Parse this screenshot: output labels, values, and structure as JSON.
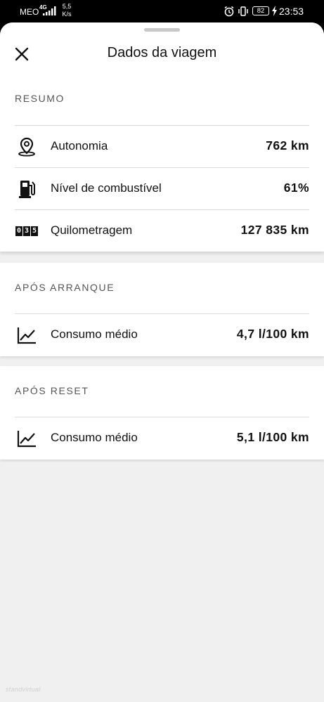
{
  "status_bar": {
    "carrier": "MEO",
    "network": "4G",
    "speed_value": "5,5",
    "speed_unit": "K/s",
    "battery": "82",
    "time": "23:53"
  },
  "header": {
    "title": "Dados da viagem",
    "close_icon": "close-icon"
  },
  "sections": [
    {
      "label": "RESUMO",
      "rows": [
        {
          "icon": "location-pin-icon",
          "label": "Autonomia",
          "value": "762 km"
        },
        {
          "icon": "fuel-pump-icon",
          "label": "Nível de combustível",
          "value": "61%"
        },
        {
          "icon": "odometer-icon",
          "label": "Quilometragem",
          "value": "127 835 km",
          "odometer_digits": [
            "0",
            "3",
            "5"
          ]
        }
      ]
    },
    {
      "label": "APÓS ARRANQUE",
      "rows": [
        {
          "icon": "trend-chart-icon",
          "label": "Consumo médio",
          "value": "4,7 l/100 km"
        }
      ]
    },
    {
      "label": "APÓS RESET",
      "rows": [
        {
          "icon": "trend-chart-icon",
          "label": "Consumo médio",
          "value": "5,1 l/100 km"
        }
      ]
    }
  ],
  "watermark": "standvirtual"
}
